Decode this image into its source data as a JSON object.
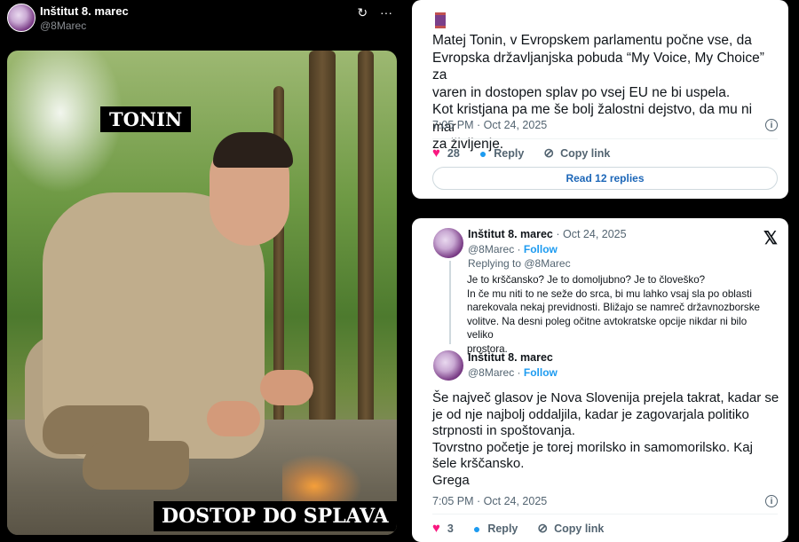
{
  "left": {
    "author_name": "Inštitut 8. marec",
    "author_handle": "@8Marec",
    "icons": [
      "refresh-icon",
      "more-icon"
    ],
    "more_symbol": "···",
    "refresh_symbol": "↻",
    "image_caption_top": "TONIN",
    "image_caption_bottom": "DOSTOP DO SPLAVA"
  },
  "tweet1": {
    "text_lines": [
      "Matej Tonin, v Evropskem parlamentu počne vse, da",
      "Evropska državljanjska pobuda “My Voice, My Choice” za",
      "varen in dostopen splav po vsej EU ne bi uspela.",
      "Kot kristjana pa me še bolj žalostni dejstvo, da mu ni mar",
      "za življenje."
    ],
    "timestamp": "7:05 PM · Oct 24, 2025",
    "likes": "28",
    "reply_label": "Reply",
    "copy_label": "Copy link",
    "read_replies": "Read 12 replies"
  },
  "tweet2": {
    "author": "Inštitut 8. marec",
    "meta": "· Oct 24, 2025",
    "handle": "@8Marec",
    "dot": "·",
    "follow": "Follow",
    "replying_to": "Replying to @8Marec",
    "quoted_lines": [
      "Je to krščansko? Je to domoljubno? Je to človeško?",
      "In če mu niti to ne seže do srca, bi mu lahko vsaj sla po oblasti",
      "narekovala nekaj previdnosti. Bližajo se namreč državnozborske",
      "volitve. Na desni poleg očitne avtokratske opcije nikdar ni bilo veliko",
      "prostora."
    ],
    "author2": "Inštitut 8. marec",
    "handle2": "@8Marec",
    "follow2": "Follow",
    "text_lines": [
      "Še največ glasov je Nova Slovenija prejela takrat, kadar se",
      "je od nje najbolj oddaljila, kadar je zagovarjala politiko",
      "strpnosti in spoštovanja.",
      "Tovrstno početje je torej morilsko in samomorilsko. Kaj",
      "šele krščansko.",
      "Grega"
    ],
    "timestamp": "7:05 PM · Oct 24, 2025",
    "likes": "3",
    "reply_label": "Reply",
    "copy_label": "Copy link"
  },
  "colors": {
    "like": "#f91880",
    "accent": "#1d9bf0",
    "text": "#0f1419",
    "muted": "#536471"
  }
}
